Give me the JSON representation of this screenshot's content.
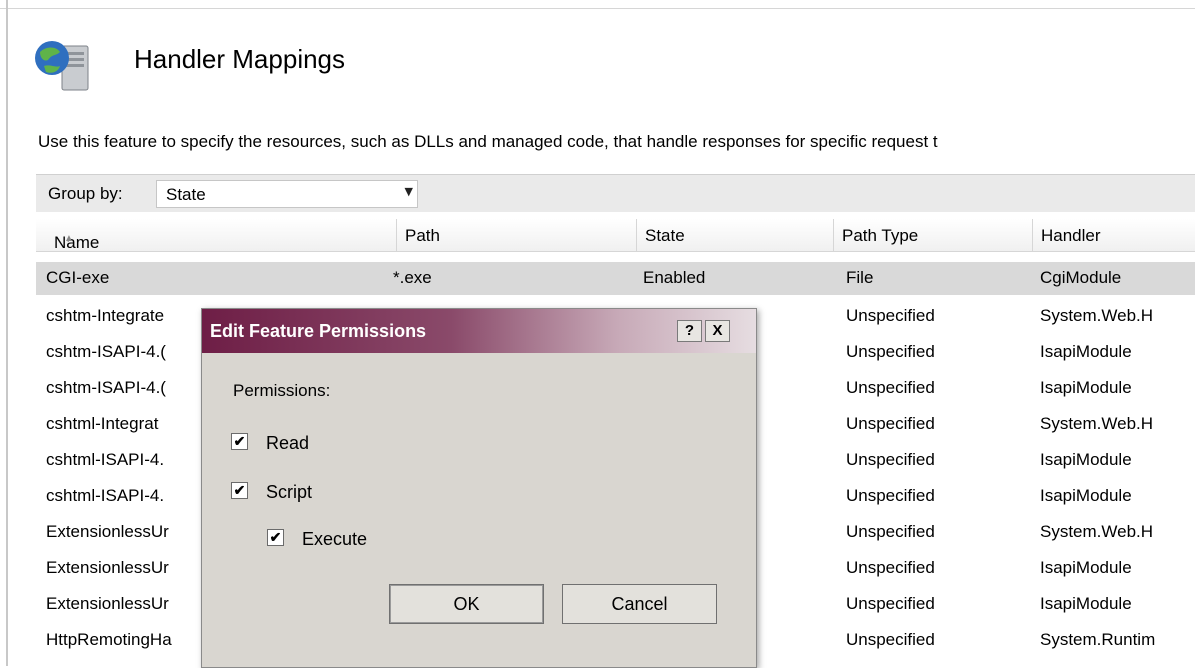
{
  "header": {
    "title": "Handler Mappings",
    "icon": "server-globe-icon",
    "description": "Use this feature to specify the resources, such as DLLs and managed code, that handle responses for specific request t"
  },
  "group_by": {
    "label": "Group by:",
    "value": "State"
  },
  "columns": [
    "Name",
    "Path",
    "State",
    "Path Type",
    "Handler"
  ],
  "rows": [
    {
      "name": "CGI-exe",
      "path": "*.exe",
      "state": "Enabled",
      "path_type": "File",
      "handler": "CgiModule",
      "selected": true
    },
    {
      "name": "cshtm-Integrate",
      "path": "",
      "state": "",
      "path_type": "Unspecified",
      "handler": "System.Web.H"
    },
    {
      "name": "cshtm-ISAPI-4.(",
      "path": "",
      "state": "",
      "path_type": "Unspecified",
      "handler": "IsapiModule"
    },
    {
      "name": "cshtm-ISAPI-4.(",
      "path": "",
      "state": "",
      "path_type": "Unspecified",
      "handler": "IsapiModule"
    },
    {
      "name": "cshtml-Integrat",
      "path": "",
      "state": "",
      "path_type": "Unspecified",
      "handler": "System.Web.H"
    },
    {
      "name": "cshtml-ISAPI-4.",
      "path": "",
      "state": "",
      "path_type": "Unspecified",
      "handler": "IsapiModule"
    },
    {
      "name": "cshtml-ISAPI-4.",
      "path": "",
      "state": "",
      "path_type": "Unspecified",
      "handler": "IsapiModule"
    },
    {
      "name": "ExtensionlessUr",
      "path": "",
      "state": "",
      "path_type": "Unspecified",
      "handler": "System.Web.H"
    },
    {
      "name": "ExtensionlessUr",
      "path": "",
      "state": "",
      "path_type": "Unspecified",
      "handler": "IsapiModule"
    },
    {
      "name": "ExtensionlessUr",
      "path": "",
      "state": "",
      "path_type": "Unspecified",
      "handler": "IsapiModule"
    },
    {
      "name": "HttpRemotingHa",
      "path": "",
      "state": "",
      "path_type": "Unspecified",
      "handler": "System.Runtim"
    }
  ],
  "dialog": {
    "title": "Edit Feature Permissions",
    "help_glyph": "?",
    "close_glyph": "X",
    "permissions_label": "Permissions:",
    "read_label": "Read",
    "script_label": "Script",
    "execute_label": "Execute",
    "read_checked": true,
    "script_checked": true,
    "execute_checked": true,
    "ok_label": "OK",
    "cancel_label": "Cancel"
  }
}
